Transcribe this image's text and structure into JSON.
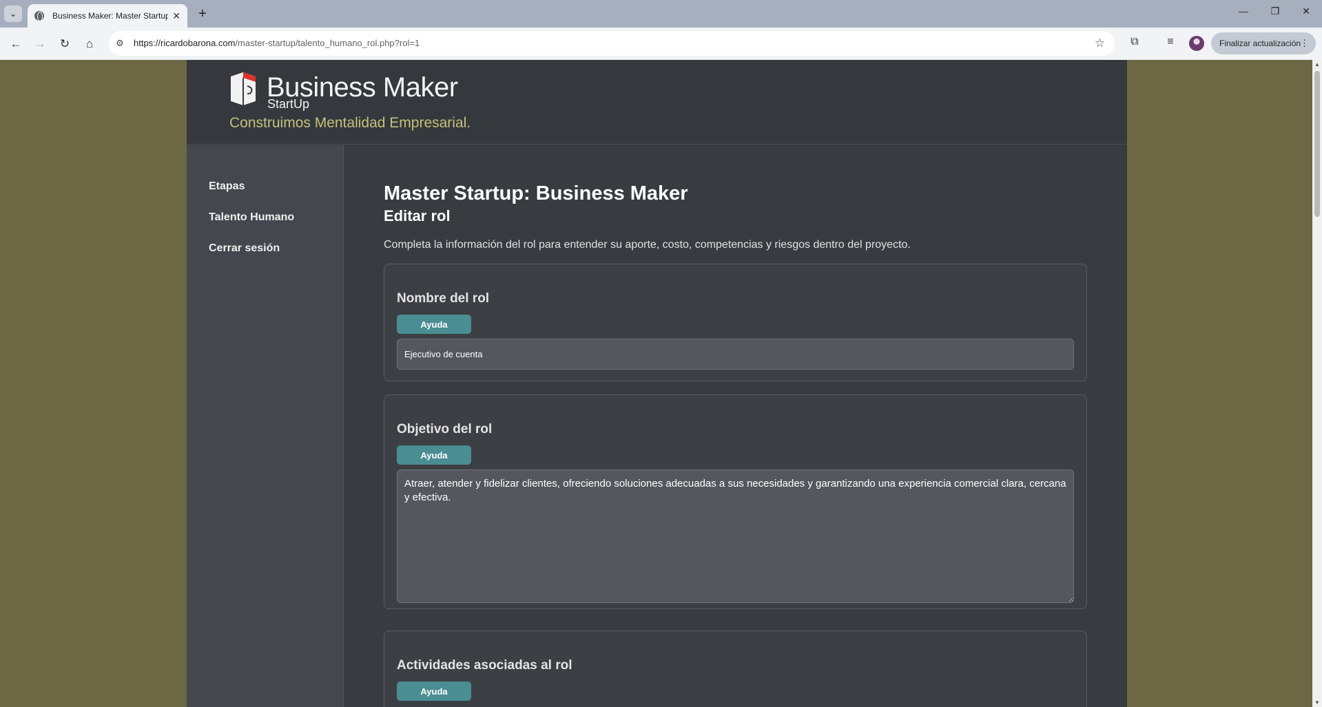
{
  "browser": {
    "tab_title": "Business Maker: Master Startup",
    "url_host": "https://ricardobarona.com",
    "url_path": "/master-startup/talento_humano_rol.php?rol=1",
    "update_label": "Finalizar actualización"
  },
  "site": {
    "brand_name": "Business Maker",
    "brand_sub": "StartUp",
    "tagline": "Construimos Mentalidad Empresarial.",
    "brand_colors": {
      "tagline": "#c2c279",
      "accent": "#4a8d92",
      "logo_red": "#d9342b"
    }
  },
  "sidebar": {
    "items": [
      {
        "label": "Etapas"
      },
      {
        "label": "Talento Humano"
      },
      {
        "label": "Cerrar sesión"
      }
    ]
  },
  "main": {
    "title": "Master Startup: Business Maker",
    "subtitle": "Editar rol",
    "intro": "Completa la información del rol para entender su aporte, costo, competencias y riesgos dentro del proyecto.",
    "sections": [
      {
        "label": "Nombre del rol",
        "help_label": "Ayuda",
        "value": "Ejecutivo de cuenta"
      },
      {
        "label": "Objetivo del rol",
        "help_label": "Ayuda",
        "value": "Atraer, atender y fidelizar clientes, ofreciendo soluciones adecuadas a sus necesidades y garantizando una experiencia comercial clara, cercana y efectiva."
      },
      {
        "label": "Actividades asociadas al rol",
        "help_label": "Ayuda"
      }
    ]
  }
}
